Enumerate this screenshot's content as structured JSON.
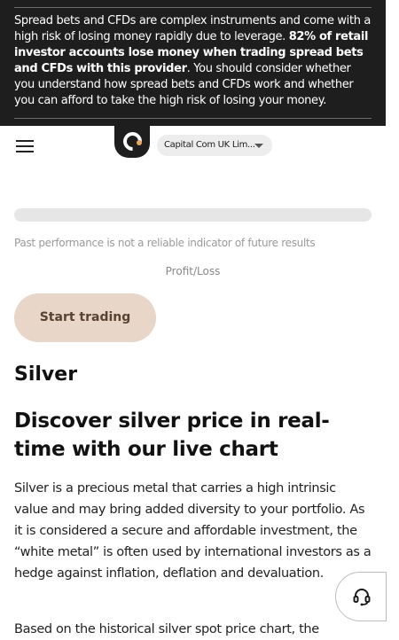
{
  "risk_warning": {
    "text_before": "Spread bets and CFDs are complex instruments and come with a high risk of losing money rapidly due to leverage. ",
    "text_bold": "82% of retail investor accounts lose money when trading spread bets and CFDs with this provider",
    "text_after": ". You should consider whether you understand how spread bets and CFDs work and whether you can afford to take the high risk of losing your money."
  },
  "header": {
    "entity_selector": "Capital Com UK Lim..."
  },
  "disclaimer": "Past performance is not a reliable indicator of future results",
  "profit_loss_label": "Profit/Loss",
  "cta": {
    "start_trading": "Start trading"
  },
  "content": {
    "title": "Silver",
    "subtitle": "Discover silver price in real-time with our live chart",
    "paragraph1": "Silver is a precious metal that carries a high intrinsic value and may bring added diversity to your portfolio. As it is considered a secure and affordable investment, the “white metal” is often used by international investors as a hedge against inflation, deflation and devaluation.",
    "paragraph2": "Based on the historical silver spot price chart, the"
  },
  "icons": {
    "menu": "hamburger-menu-icon",
    "logo": "capital-com-logo",
    "dropdown": "chevron-down-icon",
    "support": "headset-support-icon"
  },
  "colors": {
    "banner_bg": "#1e1e1e",
    "button_bg": "#e8d7c9",
    "logo_dot": "#e8a75a"
  }
}
